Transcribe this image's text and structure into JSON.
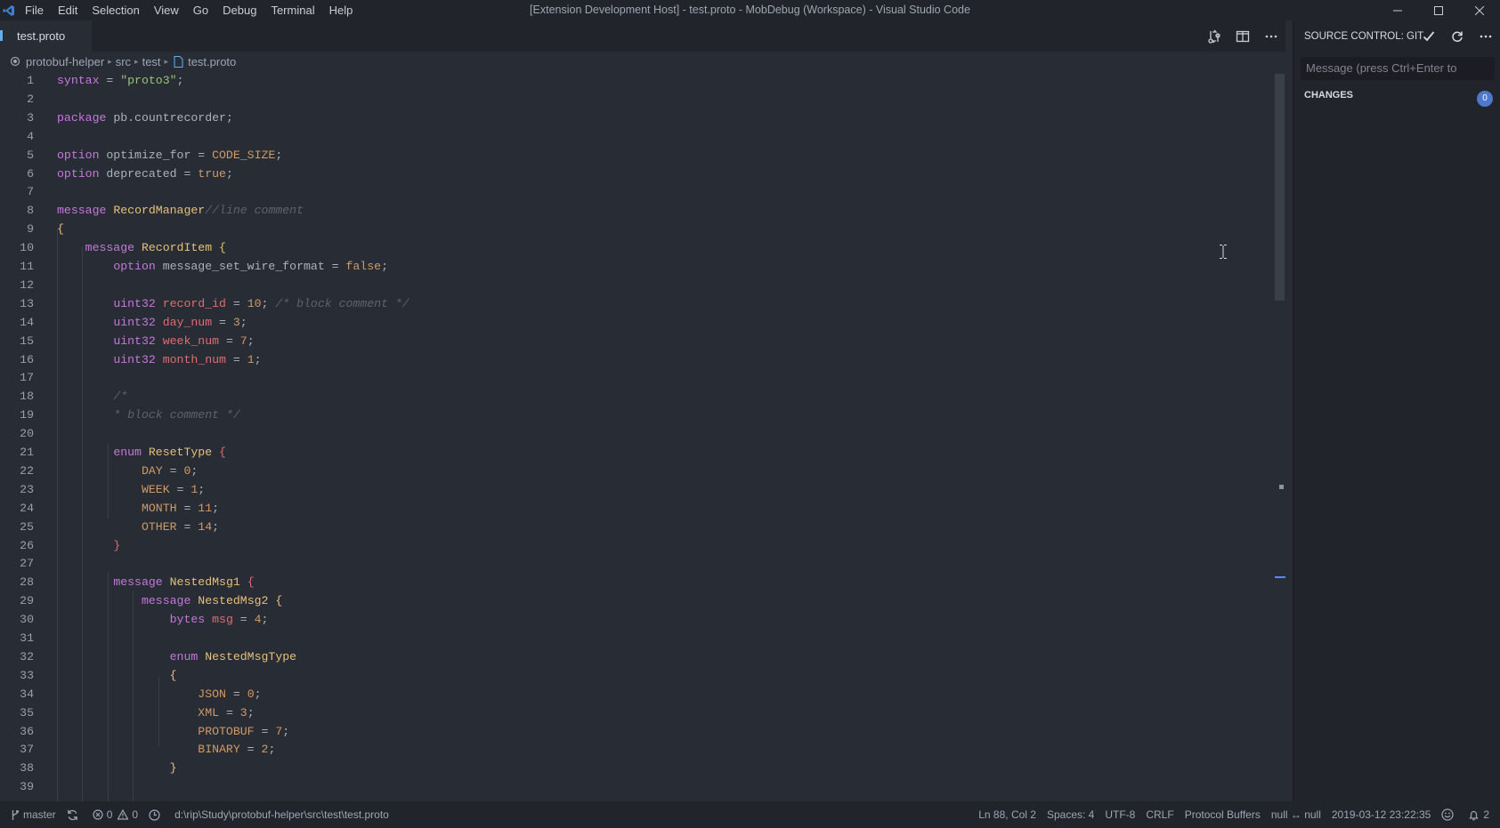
{
  "titlebar": {
    "menu": [
      "File",
      "Edit",
      "Selection",
      "View",
      "Go",
      "Debug",
      "Terminal",
      "Help"
    ],
    "window_title": "[Extension Development Host] - test.proto - MobDebug (Workspace) - Visual Studio Code"
  },
  "tab": {
    "label": "test.proto"
  },
  "breadcrumbs": [
    "protobuf-helper",
    "src",
    "test",
    "test.proto"
  ],
  "editor": {
    "lines": [
      {
        "n": "1",
        "toks": [
          [
            "k",
            "syntax"
          ],
          [
            "p",
            " = "
          ],
          [
            "s",
            "\"proto3\""
          ],
          [
            "p",
            ";"
          ]
        ]
      },
      {
        "n": "2",
        "toks": []
      },
      {
        "n": "3",
        "toks": [
          [
            "k",
            "package"
          ],
          [
            "p",
            " pb.countrecorder;"
          ]
        ]
      },
      {
        "n": "4",
        "toks": []
      },
      {
        "n": "5",
        "toks": [
          [
            "k",
            "option"
          ],
          [
            "p",
            " optimize_for = "
          ],
          [
            "n",
            "CODE_SIZE"
          ],
          [
            "p",
            ";"
          ]
        ]
      },
      {
        "n": "6",
        "toks": [
          [
            "k",
            "option"
          ],
          [
            "p",
            " deprecated = "
          ],
          [
            "n",
            "true"
          ],
          [
            "p",
            ";"
          ]
        ]
      },
      {
        "n": "7",
        "toks": []
      },
      {
        "n": "8",
        "toks": [
          [
            "k",
            "message"
          ],
          [
            "p",
            " "
          ],
          [
            "t",
            "RecordManager"
          ],
          [
            "c",
            "//line comment"
          ]
        ]
      },
      {
        "n": "9",
        "toks": [
          [
            "bg",
            "{"
          ]
        ]
      },
      {
        "n": "10",
        "toks": [
          [
            "p",
            "    "
          ],
          [
            "k",
            "message"
          ],
          [
            "p",
            " "
          ],
          [
            "t",
            "RecordItem"
          ],
          [
            "p",
            " "
          ],
          [
            "bg",
            "{"
          ]
        ]
      },
      {
        "n": "11",
        "toks": [
          [
            "p",
            "        "
          ],
          [
            "k",
            "option"
          ],
          [
            "p",
            " message_set_wire_format = "
          ],
          [
            "n",
            "false"
          ],
          [
            "p",
            ";"
          ]
        ]
      },
      {
        "n": "12",
        "toks": []
      },
      {
        "n": "13",
        "toks": [
          [
            "p",
            "        "
          ],
          [
            "k",
            "uint32"
          ],
          [
            "p",
            " "
          ],
          [
            "v",
            "record_id"
          ],
          [
            "p",
            " = "
          ],
          [
            "n",
            "10"
          ],
          [
            "p",
            "; "
          ],
          [
            "c",
            "/* block comment */"
          ]
        ]
      },
      {
        "n": "14",
        "toks": [
          [
            "p",
            "        "
          ],
          [
            "k",
            "uint32"
          ],
          [
            "p",
            " "
          ],
          [
            "v",
            "day_num"
          ],
          [
            "p",
            " = "
          ],
          [
            "n",
            "3"
          ],
          [
            "p",
            ";"
          ]
        ]
      },
      {
        "n": "15",
        "toks": [
          [
            "p",
            "        "
          ],
          [
            "k",
            "uint32"
          ],
          [
            "p",
            " "
          ],
          [
            "v",
            "week_num"
          ],
          [
            "p",
            " = "
          ],
          [
            "n",
            "7"
          ],
          [
            "p",
            ";"
          ]
        ]
      },
      {
        "n": "16",
        "toks": [
          [
            "p",
            "        "
          ],
          [
            "k",
            "uint32"
          ],
          [
            "p",
            " "
          ],
          [
            "v",
            "month_num"
          ],
          [
            "p",
            " = "
          ],
          [
            "n",
            "1"
          ],
          [
            "p",
            ";"
          ]
        ]
      },
      {
        "n": "17",
        "toks": []
      },
      {
        "n": "18",
        "toks": [
          [
            "p",
            "        "
          ],
          [
            "c",
            "/*"
          ]
        ]
      },
      {
        "n": "19",
        "toks": [
          [
            "p",
            "        "
          ],
          [
            "c",
            "* block comment */"
          ]
        ]
      },
      {
        "n": "20",
        "toks": []
      },
      {
        "n": "21",
        "toks": [
          [
            "p",
            "        "
          ],
          [
            "k",
            "enum"
          ],
          [
            "p",
            " "
          ],
          [
            "t",
            "ResetType"
          ],
          [
            "p",
            " "
          ],
          [
            "b",
            "{"
          ]
        ]
      },
      {
        "n": "22",
        "toks": [
          [
            "p",
            "            "
          ],
          [
            "n",
            "DAY"
          ],
          [
            "p",
            " = "
          ],
          [
            "n",
            "0"
          ],
          [
            "p",
            ";"
          ]
        ]
      },
      {
        "n": "23",
        "toks": [
          [
            "p",
            "            "
          ],
          [
            "n",
            "WEEK"
          ],
          [
            "p",
            " = "
          ],
          [
            "n",
            "1"
          ],
          [
            "p",
            ";"
          ]
        ]
      },
      {
        "n": "24",
        "toks": [
          [
            "p",
            "            "
          ],
          [
            "n",
            "MONTH"
          ],
          [
            "p",
            " = "
          ],
          [
            "n",
            "11"
          ],
          [
            "p",
            ";"
          ]
        ]
      },
      {
        "n": "25",
        "toks": [
          [
            "p",
            "            "
          ],
          [
            "n",
            "OTHER"
          ],
          [
            "p",
            " = "
          ],
          [
            "n",
            "14"
          ],
          [
            "p",
            ";"
          ]
        ]
      },
      {
        "n": "26",
        "toks": [
          [
            "p",
            "        "
          ],
          [
            "b",
            "}"
          ]
        ]
      },
      {
        "n": "27",
        "toks": []
      },
      {
        "n": "28",
        "toks": [
          [
            "p",
            "        "
          ],
          [
            "k",
            "message"
          ],
          [
            "p",
            " "
          ],
          [
            "t",
            "NestedMsg1"
          ],
          [
            "p",
            " "
          ],
          [
            "b",
            "{"
          ]
        ]
      },
      {
        "n": "29",
        "toks": [
          [
            "p",
            "            "
          ],
          [
            "k",
            "message"
          ],
          [
            "p",
            " "
          ],
          [
            "t",
            "NestedMsg2"
          ],
          [
            "p",
            " "
          ],
          [
            "bg",
            "{"
          ]
        ]
      },
      {
        "n": "30",
        "toks": [
          [
            "p",
            "                "
          ],
          [
            "k",
            "bytes"
          ],
          [
            "p",
            " "
          ],
          [
            "v",
            "msg"
          ],
          [
            "p",
            " = "
          ],
          [
            "n",
            "4"
          ],
          [
            "p",
            ";"
          ]
        ]
      },
      {
        "n": "31",
        "toks": []
      },
      {
        "n": "32",
        "toks": [
          [
            "p",
            "                "
          ],
          [
            "k",
            "enum"
          ],
          [
            "p",
            " "
          ],
          [
            "t",
            "NestedMsgType"
          ]
        ]
      },
      {
        "n": "33",
        "toks": [
          [
            "p",
            "                "
          ],
          [
            "bg",
            "{"
          ]
        ]
      },
      {
        "n": "34",
        "toks": [
          [
            "p",
            "                    "
          ],
          [
            "n",
            "JSON"
          ],
          [
            "p",
            " = "
          ],
          [
            "n",
            "0"
          ],
          [
            "p",
            ";"
          ]
        ]
      },
      {
        "n": "35",
        "toks": [
          [
            "p",
            "                    "
          ],
          [
            "n",
            "XML"
          ],
          [
            "p",
            " = "
          ],
          [
            "n",
            "3"
          ],
          [
            "p",
            ";"
          ]
        ]
      },
      {
        "n": "36",
        "toks": [
          [
            "p",
            "                    "
          ],
          [
            "n",
            "PROTOBUF"
          ],
          [
            "p",
            " = "
          ],
          [
            "n",
            "7"
          ],
          [
            "p",
            ";"
          ]
        ]
      },
      {
        "n": "37",
        "toks": [
          [
            "p",
            "                    "
          ],
          [
            "n",
            "BINARY"
          ],
          [
            "p",
            " = "
          ],
          [
            "n",
            "2"
          ],
          [
            "p",
            ";"
          ]
        ]
      },
      {
        "n": "38",
        "toks": [
          [
            "p",
            "                "
          ],
          [
            "bg",
            "}"
          ]
        ]
      },
      {
        "n": "39",
        "toks": []
      }
    ]
  },
  "source_control": {
    "title": "SOURCE CONTROL: GIT",
    "message_placeholder": "Message (press Ctrl+Enter to",
    "changes_label": "CHANGES",
    "changes_count": "0"
  },
  "statusbar": {
    "branch": "master",
    "errors": "0",
    "warnings": "0",
    "file_path": "d:\\rip\\Study\\protobuf-helper\\src\\test\\test.proto",
    "cursor_pos": "Ln 88, Col 2",
    "indent": "Spaces: 4",
    "encoding": "UTF-8",
    "eol": "CRLF",
    "language": "Protocol Buffers",
    "debug": "null ↔ null",
    "datetime": "2019-03-12 23:22:35",
    "notifications": "2"
  },
  "colors": {
    "keyword": "#c678dd",
    "type": "#e5c07b",
    "string": "#98c379",
    "number": "#d19a66",
    "variable": "#e06c75",
    "comment": "#5c6370",
    "accent": "#61afef"
  }
}
